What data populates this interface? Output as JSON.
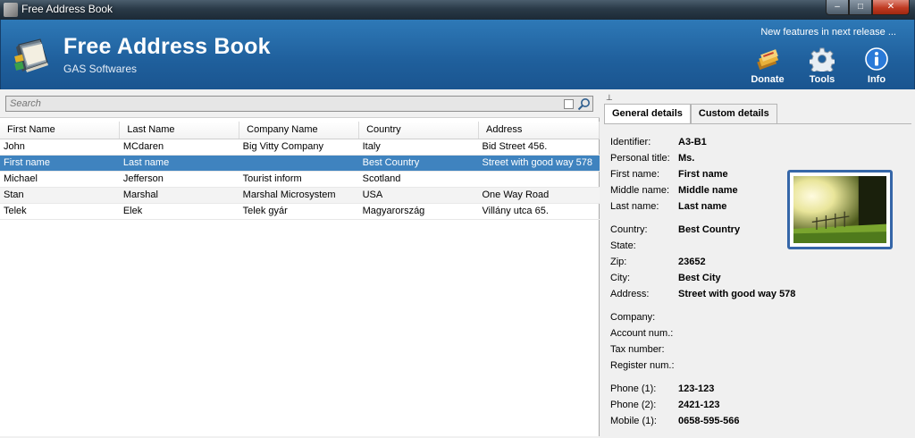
{
  "window": {
    "title": "Free Address Book",
    "min": "–",
    "max": "□",
    "close": "✕"
  },
  "header": {
    "app_title": "Free Address Book",
    "subtitle": "GAS Softwares",
    "new_features": "New features in next release ...",
    "buttons": {
      "donate": "Donate",
      "tools": "Tools",
      "info": "Info"
    }
  },
  "search": {
    "placeholder": "Search"
  },
  "grid": {
    "columns": [
      "First Name",
      "Last Name",
      "Company Name",
      "Country",
      "Address"
    ],
    "rows": [
      [
        "John",
        "MCdaren",
        "Big Vitty Company",
        "Italy",
        "Bid Street 456."
      ],
      [
        "First name",
        "Last name",
        "",
        "Best Country",
        "Street with good way 578"
      ],
      [
        "Michael",
        "Jefferson",
        "Tourist inform",
        "Scotland",
        ""
      ],
      [
        "Stan",
        "Marshal",
        "Marshal Microsystem",
        "USA",
        "One Way Road"
      ],
      [
        "Telek",
        "Elek",
        "Telek gyár",
        "Magyarország",
        "Villány utca 65."
      ]
    ],
    "selected_row": 1
  },
  "details": {
    "pin": "⊥",
    "tabs": [
      "General details",
      "Custom details"
    ],
    "fields": [
      {
        "label": "Identifier:",
        "value": "A3-B1"
      },
      {
        "label": "Personal title:",
        "value": "Ms."
      },
      {
        "label": "First name:",
        "value": "First name"
      },
      {
        "label": "Middle name:",
        "value": "Middle name"
      },
      {
        "label": "Last name:",
        "value": "Last name"
      },
      {
        "label": "Country:",
        "value": "Best Country"
      },
      {
        "label": "State:",
        "value": ""
      },
      {
        "label": "Zip:",
        "value": "23652"
      },
      {
        "label": "City:",
        "value": "Best City"
      },
      {
        "label": "Address:",
        "value": "Street with good way 578"
      },
      {
        "label": "Company:",
        "value": ""
      },
      {
        "label": "Account num.:",
        "value": ""
      },
      {
        "label": "Tax number:",
        "value": ""
      },
      {
        "label": "Register num.:",
        "value": ""
      },
      {
        "label": "Phone (1):",
        "value": "123-123"
      },
      {
        "label": "Phone (2):",
        "value": "2421-123"
      },
      {
        "label": "Mobile (1):",
        "value": "0658-595-566"
      }
    ]
  },
  "colors": {
    "header": "#1f5f9c",
    "selection": "#3f83bf",
    "photo_border": "#3566a8"
  }
}
